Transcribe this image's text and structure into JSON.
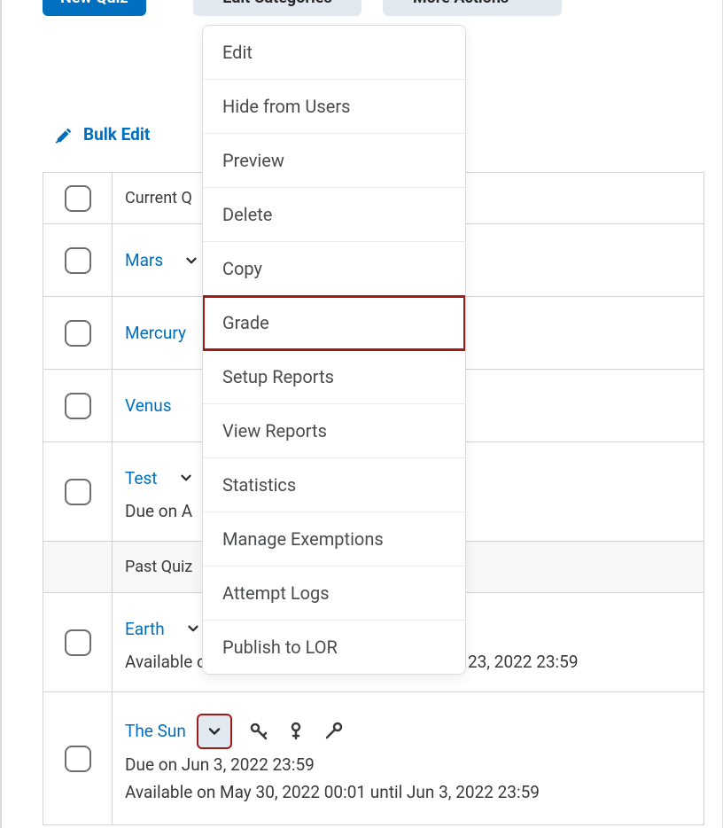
{
  "toolbar": {
    "new_quiz": "New Quiz",
    "edit_categories": "Edit Categories",
    "more_actions": "More Actions"
  },
  "bulk_edit_label": "Bulk Edit",
  "menu": {
    "items": [
      "Edit",
      "Hide from Users",
      "Preview",
      "Delete",
      "Copy",
      "Grade",
      "Setup Reports",
      "View Reports",
      "Statistics",
      "Manage Exemptions",
      "Attempt Logs",
      "Publish to LOR"
    ],
    "highlighted_index": 5
  },
  "table": {
    "header_label_visible": "Current Q",
    "rows": [
      {
        "type": "quiz",
        "title": "Mars"
      },
      {
        "type": "quiz",
        "title": "Mercury"
      },
      {
        "type": "quiz",
        "title": "Venus"
      },
      {
        "type": "quiz",
        "title": "Test",
        "due": "Due on A"
      },
      {
        "type": "section",
        "label": "Past Quiz"
      },
      {
        "type": "quiz",
        "title": "Earth",
        "availability": "Available on",
        "availability_tail": "n 23, 2022 23:59"
      },
      {
        "type": "quiz",
        "title": "The Sun",
        "due": "Due on Jun 3, 2022 23:59",
        "availability": "Available on May 30, 2022 00:01 until Jun 3, 2022 23:59",
        "chev_highlighted": true,
        "show_keys": true
      }
    ]
  },
  "colors": {
    "primary": "#006fbf",
    "highlight_border": "#a11a1a"
  }
}
